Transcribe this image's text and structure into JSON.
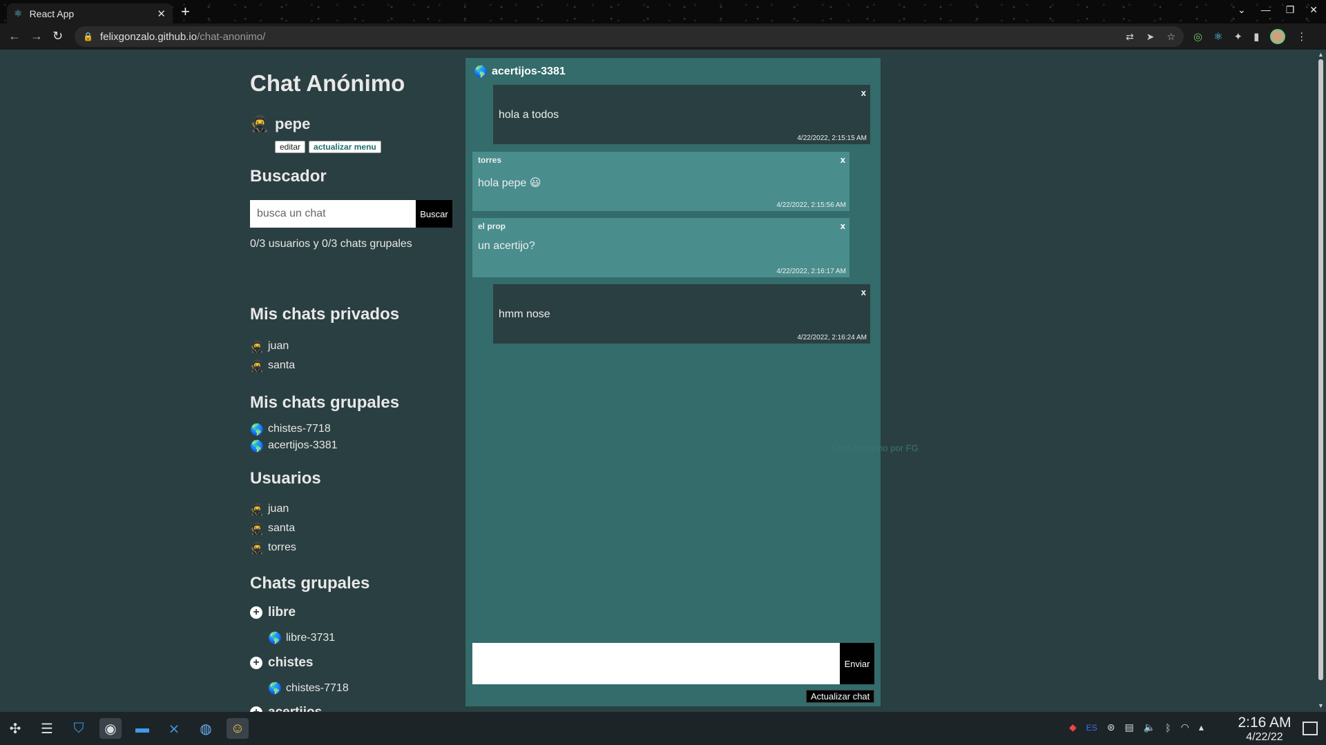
{
  "browser": {
    "tab_title": "React App",
    "url_host": "felixgonzalo.github.io",
    "url_path": "/chat-anonimo/"
  },
  "app": {
    "title": "Chat Anónimo",
    "username": "pepe",
    "user_avatar": "ninja-emoji",
    "edit_label": "editar",
    "refresh_menu_label": "actualizar menu"
  },
  "search": {
    "heading": "Buscador",
    "placeholder": "busca un chat",
    "button_label": "Buscar",
    "status": "0/3 usuarios y 0/3 chats grupales"
  },
  "private_chats": {
    "heading": "Mis chats privados",
    "items": [
      {
        "name": "juan"
      },
      {
        "name": "santa"
      }
    ]
  },
  "my_group_chats": {
    "heading": "Mis chats grupales",
    "items": [
      {
        "name": "chistes-7718"
      },
      {
        "name": "acertijos-3381"
      }
    ]
  },
  "users": {
    "heading": "Usuarios",
    "items": [
      {
        "name": "juan"
      },
      {
        "name": "santa"
      },
      {
        "name": "torres"
      }
    ]
  },
  "group_chats": {
    "heading": "Chats grupales",
    "groups": [
      {
        "name": "libre",
        "rooms": [
          "libre-3731"
        ]
      },
      {
        "name": "chistes",
        "rooms": [
          "chistes-7718"
        ]
      },
      {
        "name": "acertijos",
        "rooms": []
      }
    ]
  },
  "chat": {
    "name": "acertijos-3381",
    "icon": "globe-emoji",
    "messages": [
      {
        "own": true,
        "author": "",
        "text": "hola a todos",
        "timestamp": "4/22/2022, 2:15:15 AM"
      },
      {
        "own": false,
        "author": "torres",
        "text": "hola pepe 😃",
        "timestamp": "4/22/2022, 2:15:56 AM"
      },
      {
        "own": false,
        "author": "el prop",
        "text": "un acertijo?",
        "timestamp": "4/22/2022, 2:16:17 AM"
      },
      {
        "own": true,
        "author": "",
        "text": "hmm nose",
        "timestamp": "4/22/2022, 2:16:24 AM"
      }
    ],
    "close_label": "x",
    "send_label": "Enviar",
    "refresh_label": "Actualizar chat",
    "watermark": "Chat Anónimo por FG"
  },
  "taskbar": {
    "language": "ES",
    "time": "2:16 AM",
    "date": "4/22/22"
  },
  "colors": {
    "page_bg": "#2a3f41",
    "chat_bg": "#346b6b",
    "own_msg_bg": "#2a3f41",
    "other_msg_bg": "#4a8d8d"
  }
}
